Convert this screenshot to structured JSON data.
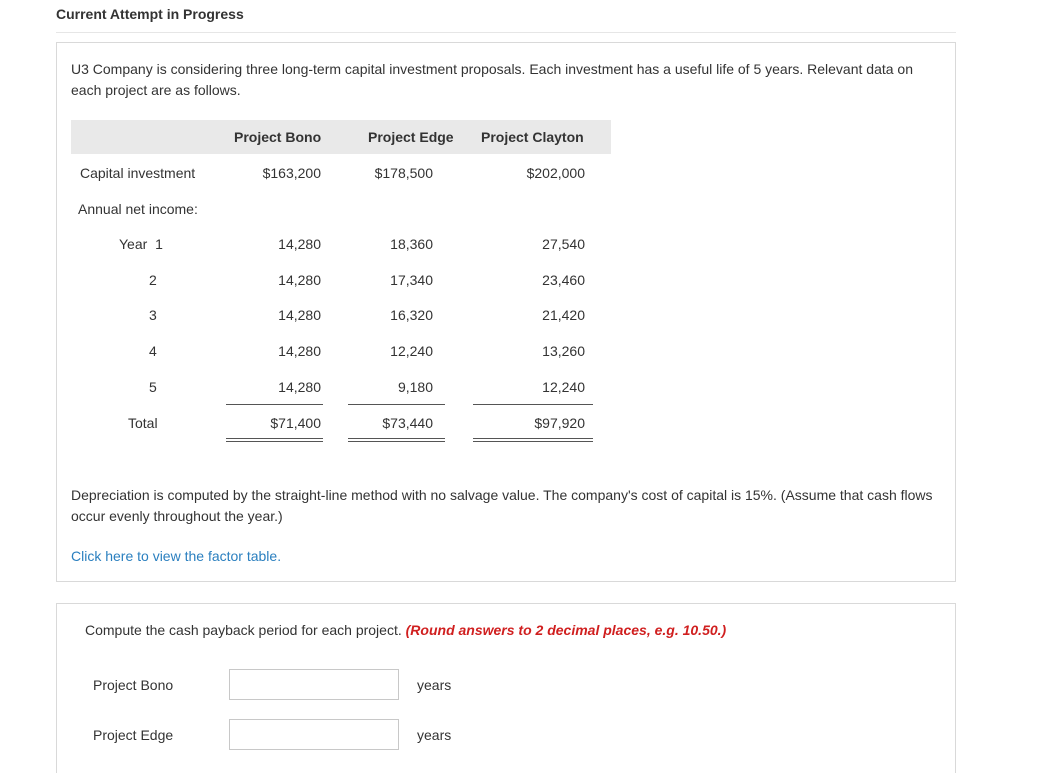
{
  "header": {
    "title": "Current Attempt in Progress"
  },
  "problem": {
    "intro": "U3 Company is considering three long-term capital investment proposals. Each investment has a useful life of 5 years. Relevant data on each project are as follows.",
    "table": {
      "columns": [
        "Project Bono",
        "Project Edge",
        "Project Clayton"
      ],
      "capital_label": "Capital investment",
      "capital": [
        "$163,200",
        "$178,500",
        "$202,000"
      ],
      "annual_label": "Annual net income:",
      "rows": [
        {
          "label": "Year  1",
          "values": [
            "14,280",
            "18,360",
            "27,540"
          ]
        },
        {
          "label": "2",
          "values": [
            "14,280",
            "17,340",
            "23,460"
          ]
        },
        {
          "label": "3",
          "values": [
            "14,280",
            "16,320",
            "21,420"
          ]
        },
        {
          "label": "4",
          "values": [
            "14,280",
            "12,240",
            "13,260"
          ]
        },
        {
          "label": "5",
          "values": [
            "14,280",
            "9,180",
            "12,240"
          ]
        }
      ],
      "total_label": "Total",
      "totals": [
        "$71,400",
        "$73,440",
        "$97,920"
      ]
    },
    "note": "Depreciation is computed by the straight-line method with no salvage value. The company's cost of capital is 15%. (Assume that cash flows occur evenly throughout the year.)",
    "factor_link": "Click here to view the factor table."
  },
  "question": {
    "instruction": "Compute the cash payback period for each project.",
    "hint": "(Round answers to 2 decimal places, e.g. 10.50.)",
    "answers": [
      {
        "label": "Project Bono",
        "value": "",
        "unit": "years"
      },
      {
        "label": "Project Edge",
        "value": "",
        "unit": "years"
      }
    ]
  },
  "colors": {
    "link": "#2a7fbf",
    "hint": "#d01f1f",
    "table_header_bg": "#e9e9e9"
  }
}
